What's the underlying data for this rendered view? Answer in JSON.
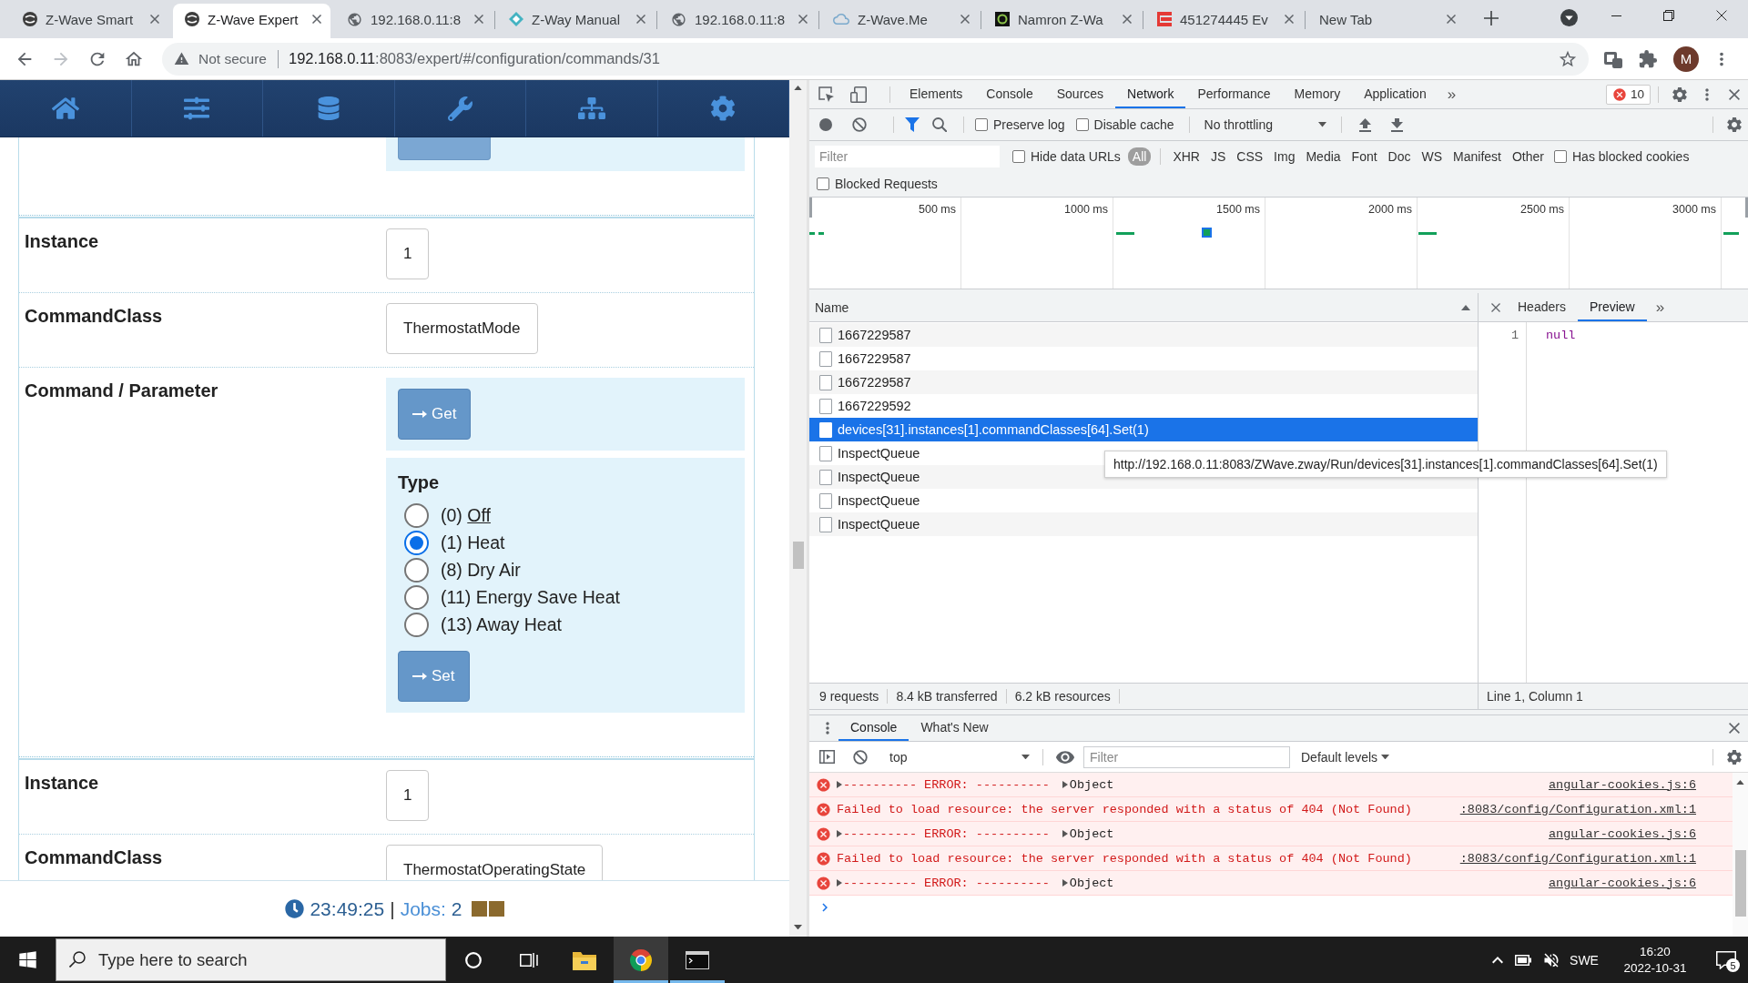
{
  "browser": {
    "tabs": [
      {
        "title": "Z-Wave Smart",
        "kind": "wave",
        "selected": false
      },
      {
        "title": "Z-Wave Expert",
        "kind": "wave",
        "selected": true
      },
      {
        "title": "192.168.0.11:8",
        "kind": "globe",
        "selected": false
      },
      {
        "title": "Z-Way Manual",
        "kind": "diamond",
        "selected": false
      },
      {
        "title": "192.168.0.11:8",
        "kind": "globe",
        "selected": false
      },
      {
        "title": "Z-Wave.Me",
        "kind": "cloud",
        "selected": false
      },
      {
        "title": "Namron Z-Wa",
        "kind": "ring",
        "selected": false
      },
      {
        "title": "451274445 Ev",
        "kind": "stripes",
        "selected": false
      },
      {
        "title": "New Tab",
        "kind": "blank",
        "selected": false
      }
    ],
    "security_label": "Not secure",
    "url_host": "192.168.0.11",
    "url_rest": ":8083/expert/#/configuration/commands/31",
    "profile_initial": "M"
  },
  "app": {
    "rows": [
      {
        "kind": "field",
        "label": "Instance",
        "value": "1"
      },
      {
        "kind": "field",
        "label": "CommandClass",
        "value": "ThermostatMode"
      },
      {
        "kind": "command",
        "label": "Command / Parameter",
        "get_button": "Get",
        "type_label": "Type",
        "options": [
          {
            "number": "(0)",
            "name": "Off",
            "underlined": true,
            "selected": false
          },
          {
            "number": "(1)",
            "name": "Heat",
            "underlined": false,
            "selected": true
          },
          {
            "number": "(8)",
            "name": "Dry Air",
            "underlined": false,
            "selected": false
          },
          {
            "number": "(11)",
            "name": "Energy Save Heat",
            "underlined": false,
            "selected": false
          },
          {
            "number": "(13)",
            "name": "Away Heat",
            "underlined": false,
            "selected": false
          }
        ],
        "set_button": "Set"
      },
      {
        "kind": "separator"
      },
      {
        "kind": "field",
        "label": "Instance",
        "value": "1"
      },
      {
        "kind": "field",
        "label": "CommandClass",
        "value": "ThermostatOperatingState"
      }
    ],
    "footer": {
      "time": "23:49:25",
      "separator": "|",
      "jobs_label": "Jobs:",
      "jobs_count": "2"
    }
  },
  "devtools": {
    "tabs": [
      {
        "label": "Elements",
        "selected": false
      },
      {
        "label": "Console",
        "selected": false
      },
      {
        "label": "Sources",
        "selected": false
      },
      {
        "label": "Network",
        "selected": true
      },
      {
        "label": "Performance",
        "selected": false
      },
      {
        "label": "Memory",
        "selected": false
      },
      {
        "label": "Application",
        "selected": false
      }
    ],
    "more": "»",
    "error_count": "10",
    "network": {
      "preserve_log": {
        "label": "Preserve log",
        "checked": false
      },
      "disable_cache": {
        "label": "Disable cache",
        "checked": false
      },
      "throttling": "No throttling",
      "filter_placeholder": "Filter",
      "hide_data_urls": {
        "label": "Hide data URLs",
        "checked": false
      },
      "types": [
        {
          "label": "All",
          "selected": true
        },
        {
          "label": "XHR",
          "selected": false
        },
        {
          "label": "JS",
          "selected": false
        },
        {
          "label": "CSS",
          "selected": false
        },
        {
          "label": "Img",
          "selected": false
        },
        {
          "label": "Media",
          "selected": false
        },
        {
          "label": "Font",
          "selected": false
        },
        {
          "label": "Doc",
          "selected": false
        },
        {
          "label": "WS",
          "selected": false
        },
        {
          "label": "Manifest",
          "selected": false
        },
        {
          "label": "Other",
          "selected": false
        }
      ],
      "has_blocked_cookies": {
        "label": "Has blocked cookies",
        "checked": false
      },
      "blocked_requests": {
        "label": "Blocked Requests",
        "checked": false
      },
      "timeline_ticks": [
        "500 ms",
        "1000 ms",
        "1500 ms",
        "2000 ms",
        "2500 ms",
        "3000 ms"
      ],
      "name_column": "Name",
      "requests": [
        {
          "name": "1667229587",
          "selected": false
        },
        {
          "name": "1667229587",
          "selected": false
        },
        {
          "name": "1667229587",
          "selected": false
        },
        {
          "name": "1667229592",
          "selected": false
        },
        {
          "name": "devices[31].instances[1].commandClasses[64].Set(1)",
          "selected": true
        },
        {
          "name": "InspectQueue",
          "selected": false
        },
        {
          "name": "InspectQueue",
          "selected": false
        },
        {
          "name": "InspectQueue",
          "selected": false
        },
        {
          "name": "InspectQueue",
          "selected": false
        }
      ],
      "tooltip": "http://192.168.0.11:8083/ZWave.zway/Run/devices[31].instances[1].commandClasses[64].Set(1)",
      "summary": [
        "9 requests",
        "8.4 kB transferred",
        "6.2 kB resources"
      ],
      "detail_tabs": [
        {
          "label": "Headers",
          "selected": false
        },
        {
          "label": "Preview",
          "selected": true
        }
      ],
      "detail_more": "»",
      "preview_lines": [
        {
          "number": "1",
          "text": "null"
        }
      ],
      "cursor_position": "Line 1, Column 1"
    },
    "drawer": {
      "tabs": [
        {
          "label": "Console",
          "selected": true
        },
        {
          "label": "What's New",
          "selected": false
        }
      ],
      "context": "top",
      "filter_placeholder": "Filter",
      "levels": "Default levels",
      "messages": [
        {
          "kind": "object",
          "text": "---------- ERROR: ----------",
          "object": "Object",
          "source": "angular-cookies.js:6"
        },
        {
          "kind": "network",
          "text": "Failed to load resource: the server responded with a status of 404 (Not Found)",
          "source": ":8083/config/Configuration.xml:1"
        },
        {
          "kind": "object",
          "text": "---------- ERROR: ----------",
          "object": "Object",
          "source": "angular-cookies.js:6"
        },
        {
          "kind": "network",
          "text": "Failed to load resource: the server responded with a status of 404 (Not Found)",
          "source": ":8083/config/Configuration.xml:1"
        },
        {
          "kind": "object",
          "text": "---------- ERROR: ----------",
          "object": "Object",
          "source": "angular-cookies.js:6"
        }
      ]
    }
  },
  "taskbar": {
    "search_placeholder": "Type here to search",
    "apps": [
      {
        "kind": "explorer",
        "running": false,
        "active": false
      },
      {
        "kind": "chrome",
        "running": true,
        "active": true
      },
      {
        "kind": "terminal",
        "running": true,
        "active": false
      }
    ],
    "language": "SWE",
    "time": "16:20",
    "date": "2022-10-31",
    "notification_count": "5"
  }
}
